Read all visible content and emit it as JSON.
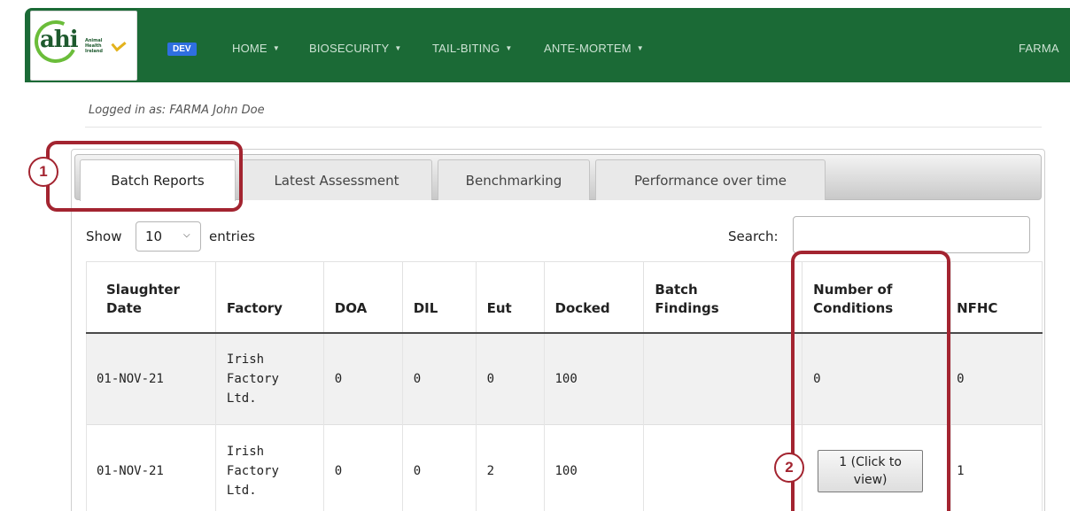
{
  "navbar": {
    "logo_text": "ahi",
    "logo_subtext": "Animal Health Ireland",
    "env_badge": "DEV",
    "items": [
      {
        "label": "HOME",
        "caret": "▼"
      },
      {
        "label": "BIOSECURITY",
        "caret": "▼"
      },
      {
        "label": "TAIL-BITING",
        "caret": "▼"
      },
      {
        "label": "ANTE-MORTEM",
        "caret": "▼"
      }
    ],
    "user_short": "FARMA"
  },
  "logged_in": "Logged in as: FARMA John Doe",
  "tabs": [
    {
      "label": "Batch Reports",
      "active": true
    },
    {
      "label": "Latest Assessment",
      "active": false
    },
    {
      "label": "Benchmarking",
      "active": false
    },
    {
      "label": "Performance over time",
      "active": false
    }
  ],
  "length_control": {
    "show": "Show",
    "value": "10",
    "entries": "entries"
  },
  "search": {
    "label": "Search:",
    "value": ""
  },
  "table": {
    "headers": {
      "slaughter_date": [
        "Slaughter",
        "Date"
      ],
      "factory": "Factory",
      "doa": "DOA",
      "dil": "DIL",
      "eut": "Eut",
      "docked": "Docked",
      "batch_findings": [
        "Batch",
        "Findings"
      ],
      "conditions": [
        "Number of",
        "Conditions"
      ],
      "nfhc": "NFHC"
    },
    "rows": [
      {
        "date": "01-NOV-21",
        "factory": [
          "Irish",
          "Factory",
          "Ltd."
        ],
        "doa": "0",
        "dil": "0",
        "eut": "0",
        "docked": "100",
        "findings": "",
        "conditions": "0",
        "nfhc": "0"
      },
      {
        "date": "01-NOV-21",
        "factory": [
          "Irish",
          "Factory",
          "Ltd."
        ],
        "doa": "0",
        "dil": "0",
        "eut": "2",
        "docked": "100",
        "findings": "",
        "conditions_button": [
          "1 (Click to",
          "view)"
        ],
        "nfhc": "1"
      }
    ]
  },
  "callouts": [
    "1",
    "2"
  ],
  "colors": {
    "navbar": "#1b6a36",
    "callout": "#a32430",
    "badge": "#2f6fe0"
  }
}
